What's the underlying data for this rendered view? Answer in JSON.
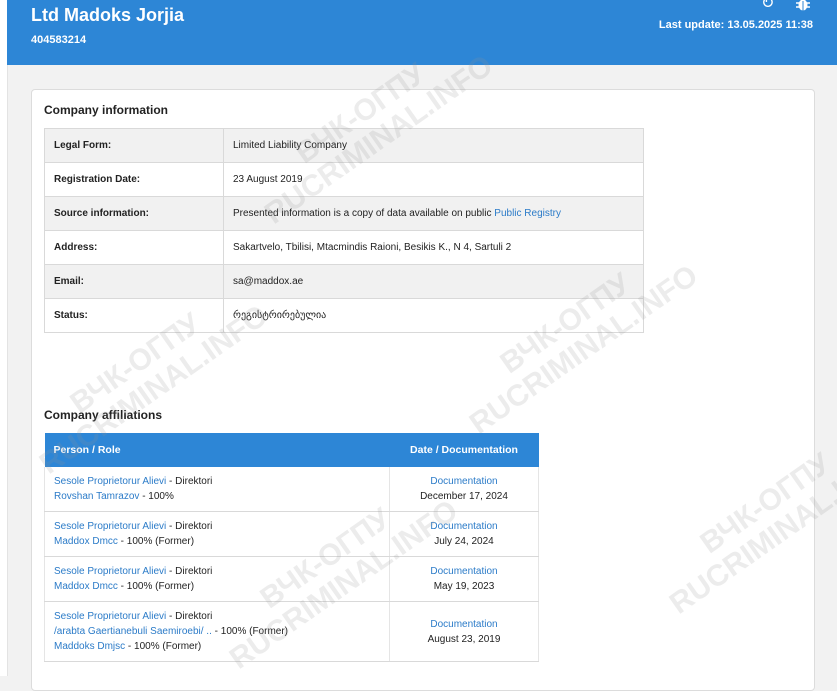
{
  "header": {
    "title": "Ltd Madoks Jorjia",
    "id_code": "404583214",
    "last_update": "Last update: 13.05.2025 11:38"
  },
  "company_info": {
    "section_title": "Company information",
    "rows": [
      {
        "label": "Legal Form:",
        "value": "Limited Liability Company"
      },
      {
        "label": "Registration Date:",
        "value": "23 August 2019"
      },
      {
        "label": "Source information:",
        "value": "Presented information is a copy of data available on public ",
        "link": "Public Registry"
      },
      {
        "label": "Address:",
        "value": "Sakartvelo, Tbilisi, Mtacmindis Raioni, Besikis K., N 4, Sartuli 2"
      },
      {
        "label": "Email:",
        "value": "sa@maddox.ae"
      },
      {
        "label": "Status:",
        "value": "რეგისტრირებულია"
      }
    ]
  },
  "affiliations": {
    "section_title": "Company affiliations",
    "col_person": "Person / Role",
    "col_date": "Date / Documentation",
    "rows": [
      {
        "lines": [
          {
            "name": "Sesole Proprietorur Alievi",
            "role": " - Direktori"
          },
          {
            "name": "Rovshan Tamrazov",
            "role": " - 100%"
          }
        ],
        "doc": "Documentation",
        "date": "December 17, 2024"
      },
      {
        "lines": [
          {
            "name": "Sesole Proprietorur Alievi",
            "role": " - Direktori"
          },
          {
            "name": "Maddox Dmcc",
            "role": " - 100% (Former)"
          }
        ],
        "doc": "Documentation",
        "date": "July 24, 2024"
      },
      {
        "lines": [
          {
            "name": "Sesole Proprietorur Alievi",
            "role": " - Direktori"
          },
          {
            "name": "Maddox Dmcc",
            "role": " - 100% (Former)"
          }
        ],
        "doc": "Documentation",
        "date": "May 19, 2023"
      },
      {
        "lines": [
          {
            "name": "Sesole Proprietorur Alievi",
            "role": " - Direktori"
          },
          {
            "name": "/arabta Gaertianebuli Saemiroebi/ ..",
            "role": " - 100% (Former)"
          },
          {
            "name": "Maddoks Dmjsc",
            "role": " - 100% (Former)"
          }
        ],
        "doc": "Documentation",
        "date": "August 23, 2019"
      }
    ]
  },
  "watermark": {
    "line1": "ВЧК-ОГПУ",
    "line2": "RUCRIMINAL.INFO"
  },
  "icons": {
    "refresh": "refresh-icon",
    "bug": "bug-icon"
  },
  "colors": {
    "header": "#2d86d6",
    "link": "#2b7bc8"
  }
}
